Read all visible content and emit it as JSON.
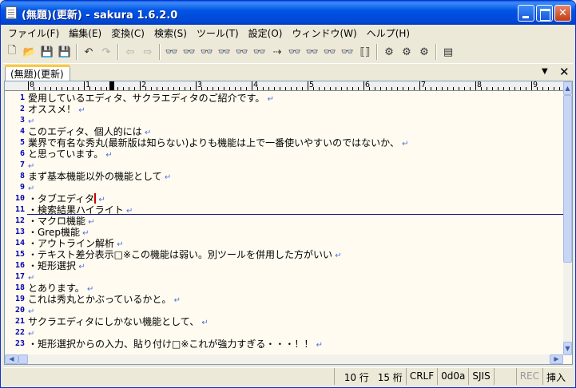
{
  "window": {
    "title": "(無題)(更新) - sakura 1.6.2.0"
  },
  "menu": [
    "ファイル(F)",
    "編集(E)",
    "変換(C)",
    "検索(S)",
    "ツール(T)",
    "設定(O)",
    "ウィンドウ(W)",
    "ヘルプ(H)"
  ],
  "toolbar": {
    "buttons": [
      {
        "name": "new-file-icon",
        "glyph": "🗋",
        "enabled": true
      },
      {
        "name": "open-file-icon",
        "glyph": "📂",
        "enabled": true
      },
      {
        "name": "save-icon",
        "glyph": "💾",
        "enabled": true
      },
      {
        "name": "save-all-icon",
        "glyph": "💾",
        "enabled": true
      },
      {
        "sep": true
      },
      {
        "name": "undo-icon",
        "glyph": "↶",
        "enabled": true
      },
      {
        "name": "redo-icon",
        "glyph": "↷",
        "enabled": false
      },
      {
        "sep": true
      },
      {
        "name": "jump-back-icon",
        "glyph": "⇦",
        "enabled": false
      },
      {
        "name": "jump-forward-icon",
        "glyph": "⇨",
        "enabled": false
      },
      {
        "sep": true
      },
      {
        "name": "search-icon",
        "glyph": "👓",
        "enabled": true
      },
      {
        "name": "search-next-icon",
        "glyph": "👓",
        "enabled": true
      },
      {
        "name": "search-prev-icon",
        "glyph": "👓",
        "enabled": true
      },
      {
        "name": "replace-icon",
        "glyph": "👓",
        "enabled": true
      },
      {
        "name": "clear-highlight-icon",
        "glyph": "👓",
        "enabled": true
      },
      {
        "name": "grep-icon",
        "glyph": "👓",
        "enabled": true
      },
      {
        "name": "tag-jump-icon",
        "glyph": "⇢",
        "enabled": true
      },
      {
        "name": "tag-back-icon",
        "glyph": "👓",
        "enabled": true
      },
      {
        "name": "compare-icon",
        "glyph": "👓",
        "enabled": false
      },
      {
        "name": "compare-next-icon",
        "glyph": "👓",
        "enabled": false
      },
      {
        "name": "compare-prev-icon",
        "glyph": "👓",
        "enabled": false
      },
      {
        "name": "bracket-match-icon",
        "glyph": "⟦⟧",
        "enabled": true
      },
      {
        "sep": true
      },
      {
        "name": "settings-icon",
        "glyph": "⚙",
        "enabled": true
      },
      {
        "name": "type-settings-icon",
        "glyph": "⚙",
        "enabled": true
      },
      {
        "name": "font-settings-icon",
        "glyph": "⚙",
        "enabled": true
      },
      {
        "sep": true
      },
      {
        "name": "outline-icon",
        "glyph": "▤",
        "enabled": true
      }
    ]
  },
  "tab": {
    "label": "(無題)(更新)"
  },
  "ruler": {
    "numbers": [
      "0",
      "1",
      "2",
      "3",
      "4",
      "5",
      "6",
      "7",
      "8",
      "9"
    ]
  },
  "lines": [
    {
      "n": "1",
      "text": "愛用しているエディタ、サクラエディタのご紹介です。",
      "eol": "↵"
    },
    {
      "n": "2",
      "text": "オススメ！",
      "eol": "↵"
    },
    {
      "n": "3",
      "text": "",
      "eol": "↵"
    },
    {
      "n": "4",
      "text": "このエディタ、個人的には",
      "eol": "↵"
    },
    {
      "n": "5",
      "text": "業界で有名な秀丸(最新版は知らない)よりも機能は上で一番使いやすいのではないか、",
      "eol": "↵"
    },
    {
      "n": "6",
      "text": "と思っています。",
      "eol": "↵"
    },
    {
      "n": "7",
      "text": "",
      "eol": "↵"
    },
    {
      "n": "8",
      "text": "まず基本機能以外の機能として",
      "eol": "↵"
    },
    {
      "n": "9",
      "text": "",
      "eol": "↵"
    },
    {
      "n": "10",
      "text": "・タブエディタ",
      "eol": "↵",
      "caret": true
    },
    {
      "n": "11",
      "text": "・検索結果ハイライト",
      "eol": "↵"
    },
    {
      "n": "12",
      "text": "・マクロ機能",
      "eol": "↵"
    },
    {
      "n": "13",
      "text": "・Grep機能",
      "eol": "↵"
    },
    {
      "n": "14",
      "text": "・アウトライン解析",
      "eol": "↵"
    },
    {
      "n": "15",
      "text": "・テキスト差分表示□※この機能は弱い。別ツールを併用した方がいい",
      "eol": "↵"
    },
    {
      "n": "16",
      "text": "・矩形選択",
      "eol": "↵"
    },
    {
      "n": "17",
      "text": "",
      "eol": "↵"
    },
    {
      "n": "18",
      "text": "とあります。",
      "eol": "↵"
    },
    {
      "n": "19",
      "text": "これは秀丸とかぶっているかと。",
      "eol": "↵"
    },
    {
      "n": "20",
      "text": "",
      "eol": "↵"
    },
    {
      "n": "21",
      "text": "サクラエディタにしかない機能として、",
      "eol": "↵"
    },
    {
      "n": "22",
      "text": "",
      "eol": "↵"
    },
    {
      "n": "23",
      "text": "・矩形選択からの入力、貼り付け□※これが強力すぎる・・・！！",
      "eol": "↵"
    }
  ],
  "status": {
    "line": "10 行",
    "col": "15 桁",
    "eol": "CRLF",
    "char_code": "0d0a",
    "encoding": "SJIS",
    "rec": "REC",
    "mode": "挿入"
  }
}
